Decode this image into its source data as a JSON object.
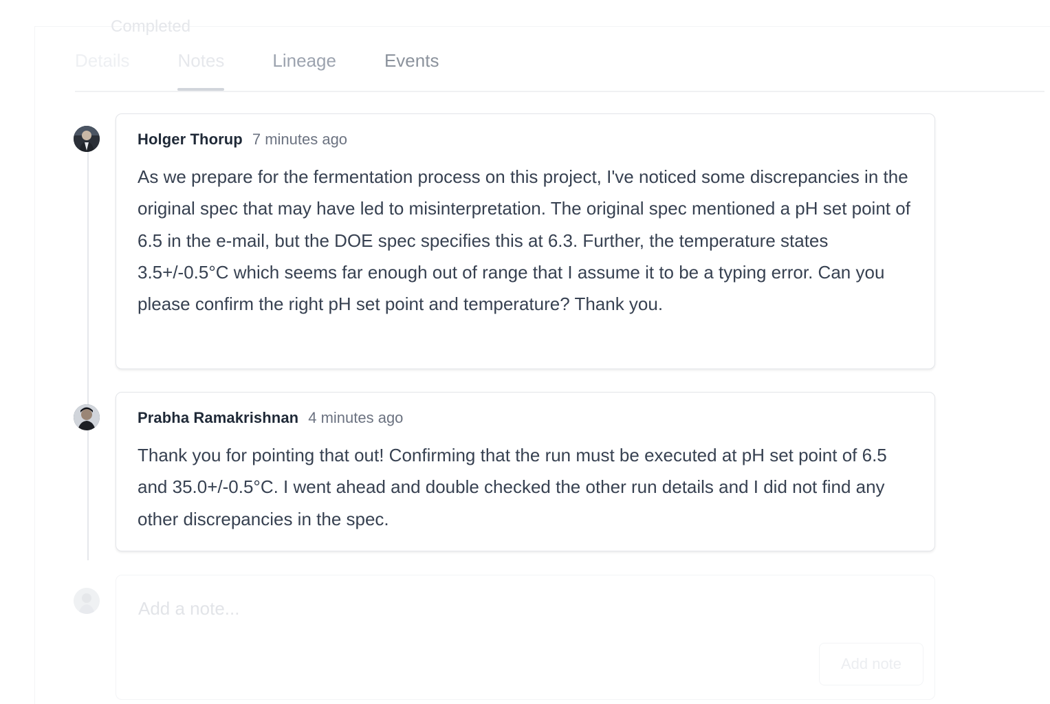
{
  "header": {
    "status": "Completed"
  },
  "tabs": [
    {
      "label": "Details",
      "active": false
    },
    {
      "label": "Notes",
      "active": true
    },
    {
      "label": "Lineage",
      "active": false
    },
    {
      "label": "Events",
      "active": false
    }
  ],
  "notes": [
    {
      "author": "Holger Thorup",
      "time": "7 minutes ago",
      "avatar_icon": "user-avatar",
      "body": "As we prepare for the fermentation process on this project, I've noticed some discrepancies in the original spec that may have led to misinterpretation. The original spec mentioned a pH set point of 6.5 in the e-mail, but the DOE spec specifies this at 6.3. Further, the temperature states 3.5+/-0.5°C which seems far enough out of range that I assume it to be a typing error. Can you please confirm the right pH set point and temperature? Thank you."
    },
    {
      "author": "Prabha Ramakrishnan",
      "time": "4 minutes ago",
      "avatar_icon": "user-avatar",
      "body": "Thank you for pointing that out! Confirming that the run must be executed at pH set point of 6.5 and 35.0+/-0.5°C. I went ahead and double checked the other run details and I did not find any other discrepancies in the spec."
    }
  ],
  "composer": {
    "placeholder": "Add a note...",
    "button_label": "Add note"
  },
  "colors": {
    "text_primary": "#1f2937",
    "text_secondary": "#6b7280",
    "border": "#e3e5e9"
  }
}
